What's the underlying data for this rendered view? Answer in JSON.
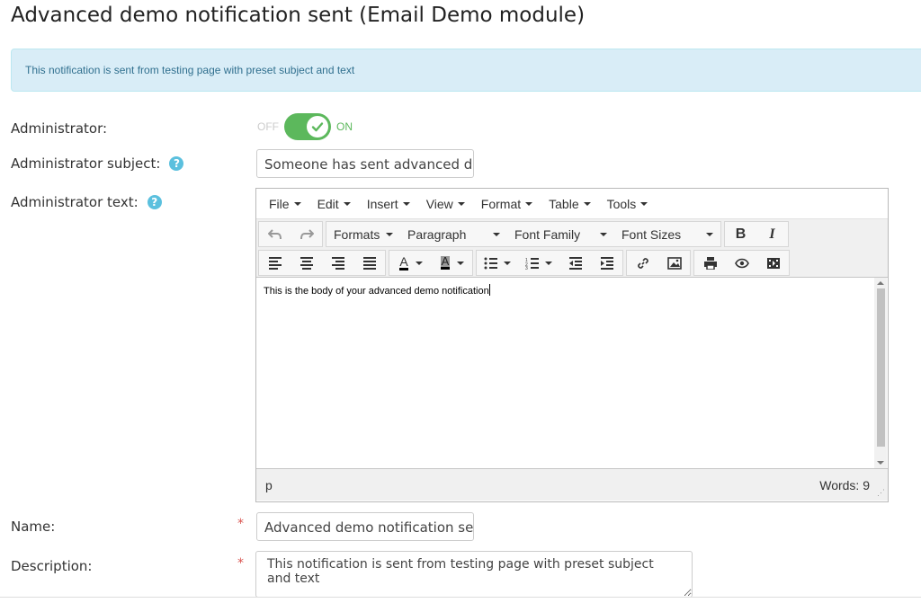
{
  "page": {
    "title": "Advanced demo notification sent (Email Demo module)",
    "info": "This notification is sent from testing page with preset subject and text"
  },
  "fields": {
    "administrator": {
      "label": "Administrator:",
      "off_label": "OFF",
      "on_label": "ON",
      "value": true
    },
    "subject": {
      "label": "Administrator subject:",
      "value": "Someone has sent advanced demo notification"
    },
    "text": {
      "label": "Administrator text:"
    },
    "name": {
      "label": "Name:",
      "required_mark": "*",
      "value": "Advanced demo notification sent"
    },
    "description": {
      "label": "Description:",
      "required_mark": "*",
      "value": "This notification is sent from testing page with preset subject and text"
    }
  },
  "editor": {
    "menu": [
      "File",
      "Edit",
      "Insert",
      "View",
      "Format",
      "Table",
      "Tools"
    ],
    "selects": {
      "formats": "Formats",
      "paragraph": "Paragraph",
      "font_family": "Font Family",
      "font_sizes": "Font Sizes"
    },
    "bold": "B",
    "italic": "I",
    "content": "This is the body of your advanced demo notification",
    "path": "p",
    "word_count": "Words: 9"
  },
  "colors": {
    "accent": "#5cb85c",
    "info_bg": "#d9edf7",
    "help": "#5bc0de",
    "required": "#d9534f"
  }
}
